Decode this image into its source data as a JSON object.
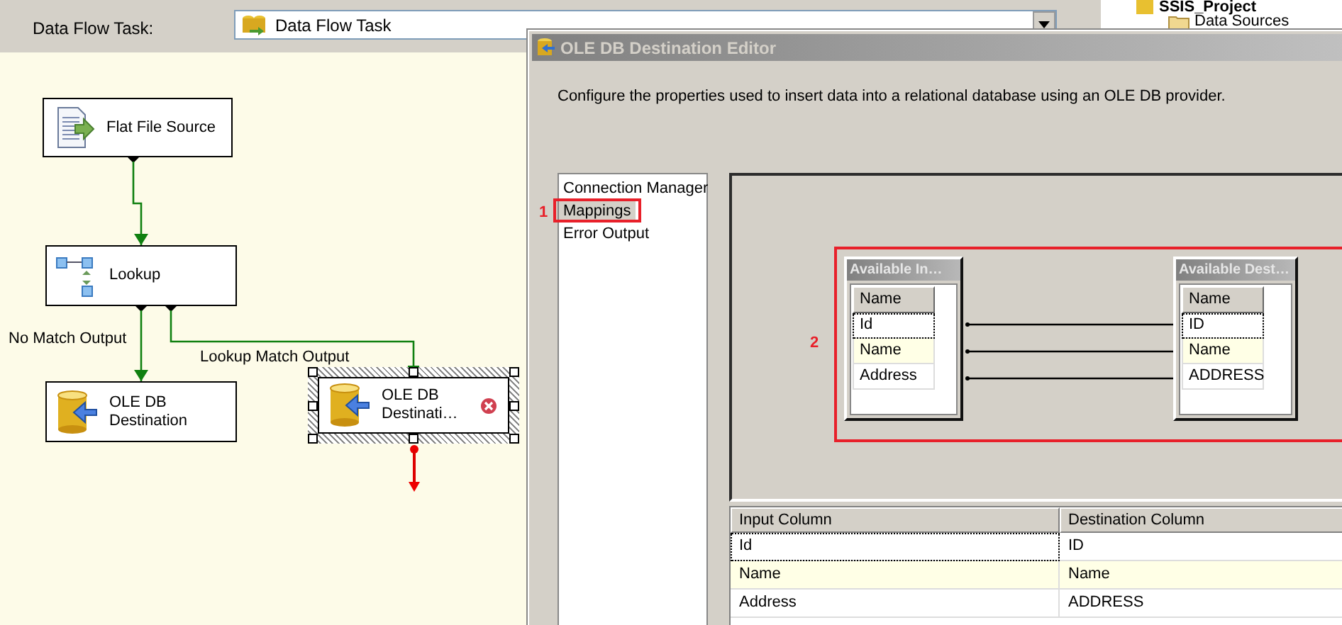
{
  "designer": {
    "task_label": "Data Flow Task:",
    "task_value": "Data Flow Task",
    "nodes": [
      {
        "kind": "source",
        "label": "Flat File Source",
        "selected": false,
        "error": false
      },
      {
        "kind": "lookup",
        "label": "Lookup",
        "selected": false,
        "error": false
      },
      {
        "kind": "destination",
        "label": "OLE DB Destination",
        "selected": false,
        "error": false
      },
      {
        "kind": "destination",
        "label": "OLE DB Destinati…",
        "selected": true,
        "error": true
      }
    ],
    "path_labels": [
      "No Match Output",
      "Lookup Match Output"
    ]
  },
  "solution_explorer": {
    "items": [
      {
        "kind": "project",
        "label": "SSIS_Project"
      },
      {
        "kind": "folder",
        "label": "Data Sources"
      }
    ]
  },
  "dialog": {
    "title": "OLE DB Destination Editor",
    "description": "Configure the properties used to insert data into a relational database using an OLE DB provider.",
    "pages": [
      {
        "label": "Connection Manager",
        "selected": false
      },
      {
        "label": "Mappings",
        "selected": true,
        "annotation": "1"
      },
      {
        "label": "Error Output",
        "selected": false
      }
    ],
    "mapping_annotation": "2",
    "available_input": {
      "title": "Available In…",
      "header": "Name",
      "columns": [
        {
          "name": "Id",
          "focused": true,
          "highlighted": false
        },
        {
          "name": "Name",
          "focused": false,
          "highlighted": true
        },
        {
          "name": "Address",
          "focused": false,
          "highlighted": false
        }
      ]
    },
    "available_destination": {
      "title": "Available Dest…",
      "header": "Name",
      "columns": [
        {
          "name": "ID",
          "focused": true,
          "highlighted": false
        },
        {
          "name": "Name",
          "focused": false,
          "highlighted": true
        },
        {
          "name": "ADDRESS",
          "focused": false,
          "highlighted": false
        }
      ]
    },
    "grid": {
      "columns": [
        "Input Column",
        "Destination Column"
      ],
      "rows": [
        {
          "input": "Id",
          "destination": "ID",
          "focused": true,
          "highlighted": false
        },
        {
          "input": "Name",
          "destination": "Name",
          "focused": false,
          "highlighted": true
        },
        {
          "input": "Address",
          "destination": "ADDRESS",
          "focused": false,
          "highlighted": false
        }
      ]
    }
  }
}
